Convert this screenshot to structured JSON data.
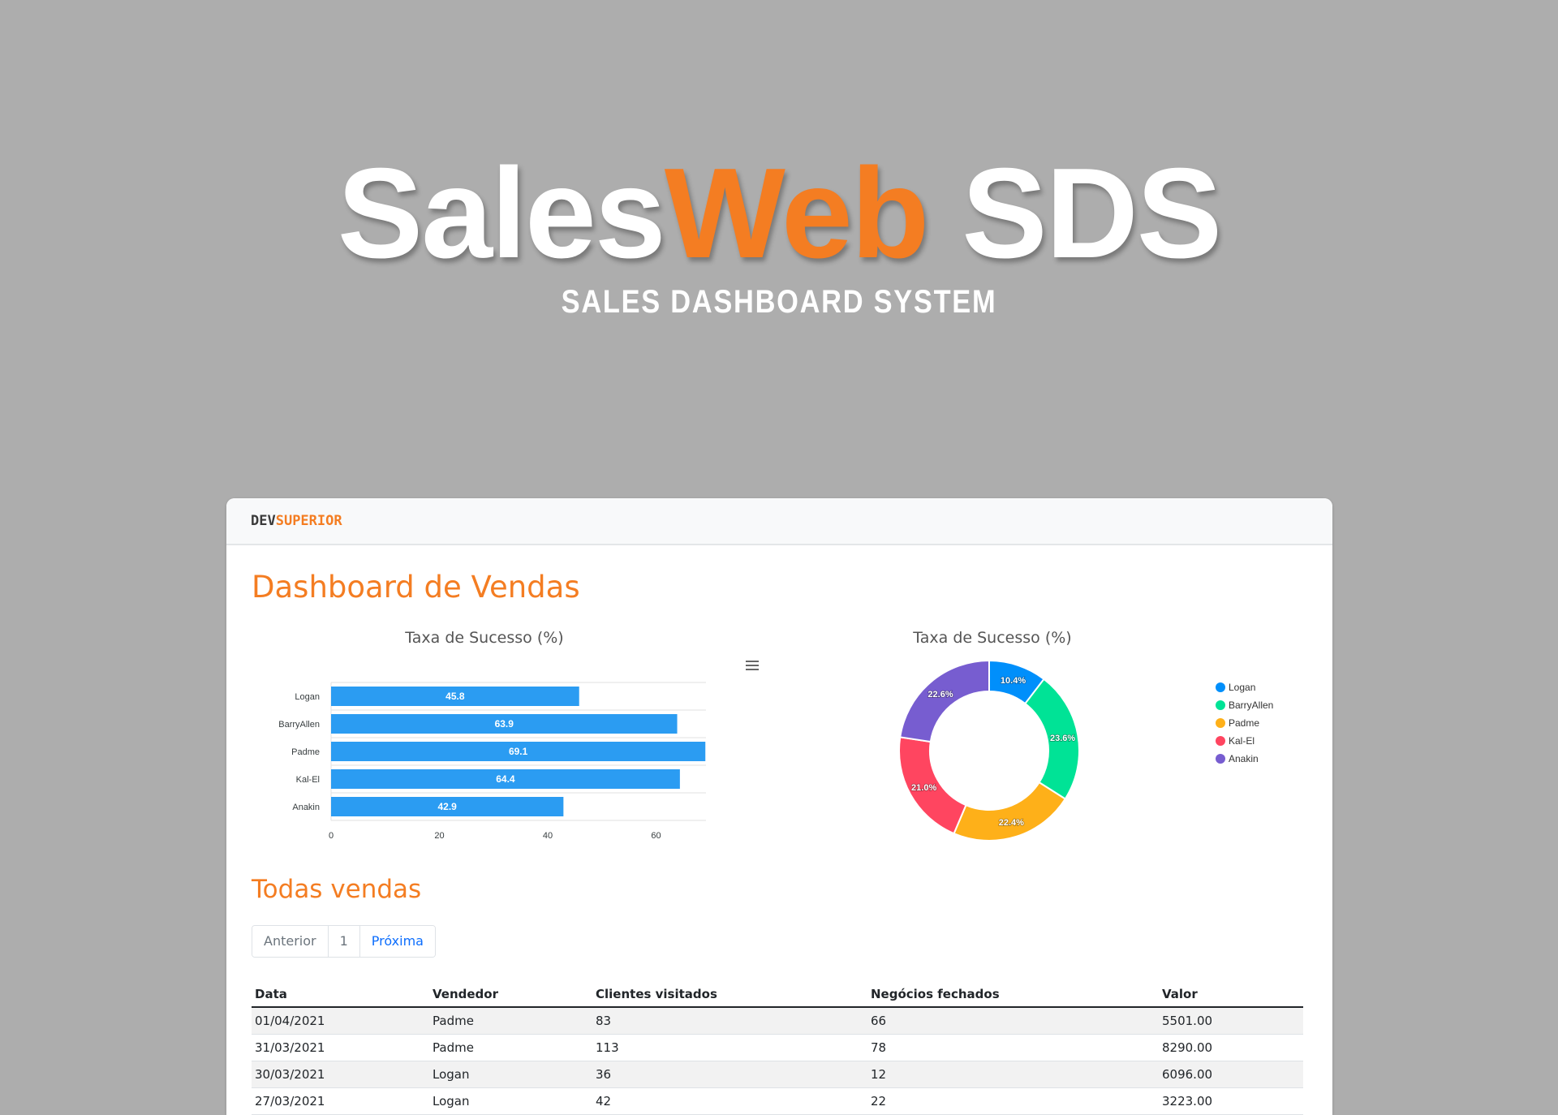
{
  "hero": {
    "title_part1": "Sales",
    "title_part2": "Web",
    "title_part3": " SDS",
    "subtitle": "SALES DASHBOARD SYSTEM"
  },
  "navbar": {
    "brand_part1": "DEV",
    "brand_part2": "SUPERIOR"
  },
  "page": {
    "title": "Dashboard de Vendas",
    "sales_title": "Todas vendas"
  },
  "colors": {
    "accent": "#f47d22",
    "bar": "#2b9cf2",
    "series": [
      "#008ffb",
      "#00e396",
      "#feb019",
      "#ff4560",
      "#775dd0"
    ]
  },
  "chart_data": [
    {
      "type": "bar",
      "orientation": "horizontal",
      "title": "Taxa de Sucesso (%)",
      "categories": [
        "Logan",
        "BarryAllen",
        "Padme",
        "Kal-El",
        "Anakin"
      ],
      "values": [
        45.8,
        63.9,
        69.1,
        64.4,
        42.9
      ],
      "xlim": [
        0,
        80
      ],
      "xticks": [
        0,
        20,
        40,
        60,
        80
      ],
      "data_labels": true,
      "grid": true
    },
    {
      "type": "pie",
      "variant": "donut",
      "title": "Taxa de Sucesso (%)",
      "labels": [
        "Logan",
        "BarryAllen",
        "Padme",
        "Kal-El",
        "Anakin"
      ],
      "values": [
        10.4,
        23.6,
        22.4,
        21.0,
        22.6
      ],
      "value_labels": [
        "10.4%",
        "23.6%",
        "22.4%",
        "21.0%",
        "22.6%"
      ],
      "legend": "right"
    }
  ],
  "pagination": {
    "prev": "Anterior",
    "page": "1",
    "next": "Próxima"
  },
  "table": {
    "headers": [
      "Data",
      "Vendedor",
      "Clientes visitados",
      "Negócios fechados",
      "Valor"
    ],
    "rows": [
      [
        "01/04/2021",
        "Padme",
        "83",
        "66",
        "5501.00"
      ],
      [
        "31/03/2021",
        "Padme",
        "113",
        "78",
        "8290.00"
      ],
      [
        "30/03/2021",
        "Logan",
        "36",
        "12",
        "6096.00"
      ],
      [
        "27/03/2021",
        "Logan",
        "42",
        "22",
        "3223.00"
      ]
    ]
  }
}
